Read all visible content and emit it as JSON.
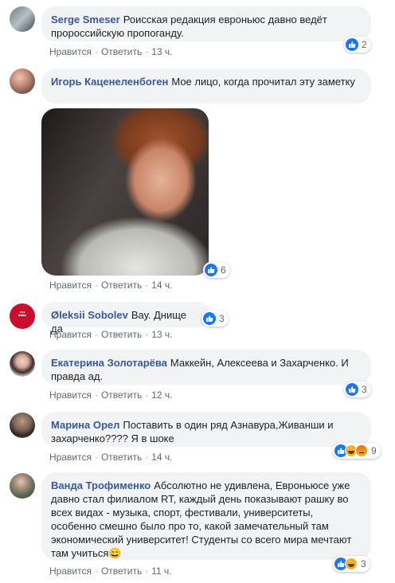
{
  "comments": [
    {
      "author": "Serge Smeser",
      "text": "Роисская редакция евроньюс давно ведёт пророссийскую пропоганду.",
      "like_label": "Нравится",
      "reply_label": "Ответить",
      "time": "13 ч.",
      "reaction_count": "2",
      "reactions": [
        "like"
      ]
    },
    {
      "author": "Игорь Каценеленбоген",
      "text": "Мое лицо, когда прочитал эту заметку",
      "like_label": "Нравится",
      "reply_label": "Ответить",
      "time": "14 ч.",
      "reaction_count": "6",
      "reactions": [
        "like"
      ],
      "has_photo": true
    },
    {
      "author": "Øleksii Sobolev",
      "text": "Вау. Днище да",
      "like_label": "Нравится",
      "reply_label": "Ответить",
      "time": "13 ч.",
      "reaction_count": "3",
      "reactions": [
        "like"
      ]
    },
    {
      "author": "Екатерина Золотарёва",
      "text": "Маккейн, Алексеева и Захарченко. И правда ад.",
      "like_label": "Нравится",
      "reply_label": "Ответить",
      "time": "12 ч.",
      "reaction_count": "3",
      "reactions": [
        "like"
      ]
    },
    {
      "author": "Марина Орел",
      "text": "Поставить в один ряд Азнавура,Живанши и захарченко???? Я в шоке",
      "like_label": "Нравится",
      "reply_label": "Ответить",
      "time": "14 ч.",
      "reaction_count": "9",
      "reactions": [
        "like",
        "haha",
        "angry"
      ]
    },
    {
      "author": "Ванда Трофименко",
      "text": "Абсолютно не удивлена, Евроньюсе уже давно стал филиалом RT, каждый день показывают рашку во всех видах - музыка, спорт, фестивали, университеты, особенно смешно было про то, какой замечательный там экономический университет! Студенты со всего мира мечтают там учиться😄",
      "like_label": "Нравится",
      "reply_label": "Ответить",
      "time": "11 ч.",
      "reaction_count": "3",
      "reactions": [
        "like",
        "haha"
      ]
    }
  ],
  "colors": {
    "author": "#385898",
    "bubble": "#f2f3f5",
    "meta": "#606770",
    "like_blue": "#1877f2",
    "haha_yellow": "#f7b125",
    "angry_orange": "#e9710f"
  },
  "icons": [
    "like-icon",
    "haha-icon",
    "angry-icon",
    "avatar"
  ]
}
